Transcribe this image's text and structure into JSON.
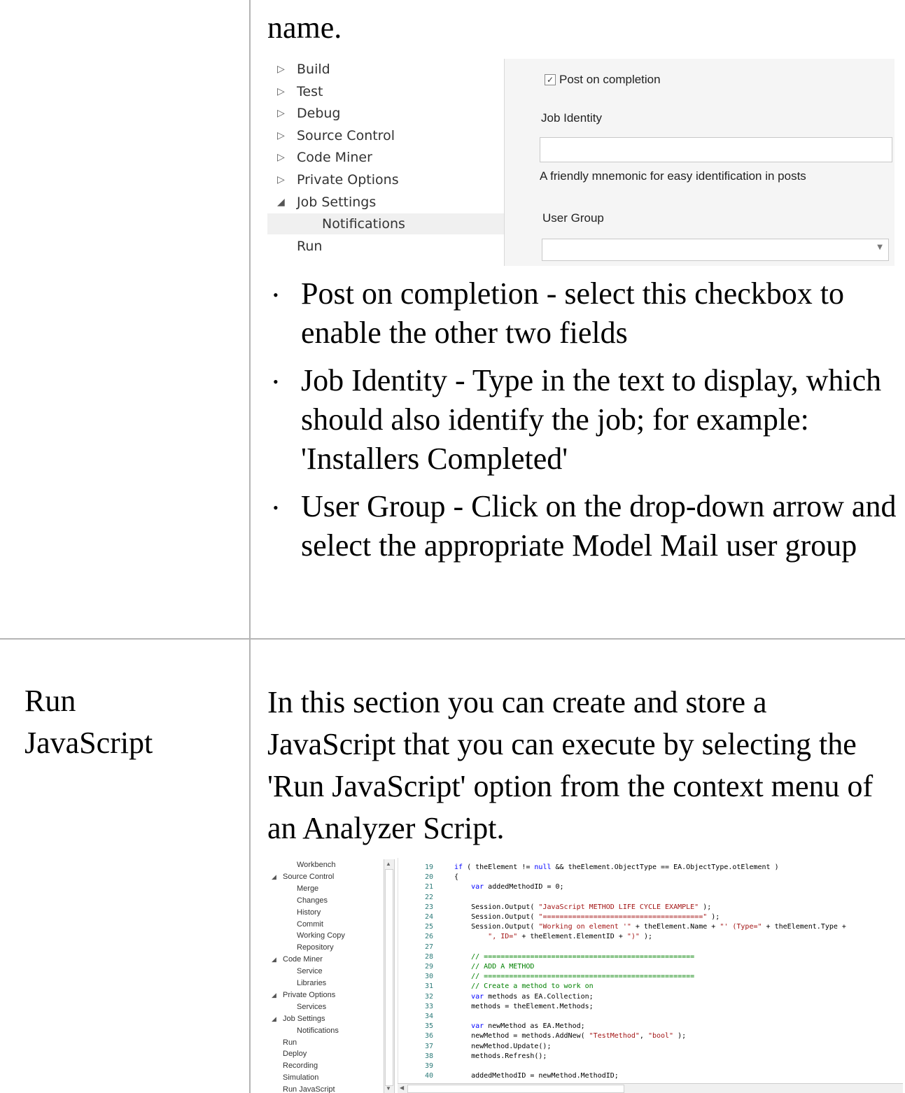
{
  "table": {
    "row1": {
      "top_text": "name.",
      "bullets": [
        "Post on completion - select this checkbox to enable the other two fields",
        "Job Identity - Type in the text to display, which should also identify the job; for example: 'Installers Completed'",
        "User Group - Click on the drop-down arrow and select the appropriate Model Mail user group"
      ]
    },
    "row2": {
      "label_line1": "Run",
      "label_line2": "JavaScript",
      "description": "In this section you can create and store a JavaScript that you can execute by selecting the 'Run JavaScript' option from the context menu of an Analyzer Script."
    }
  },
  "screenshot1": {
    "tree": [
      {
        "label": "Build",
        "arrow": "▷"
      },
      {
        "label": "Test",
        "arrow": "▷"
      },
      {
        "label": "Debug",
        "arrow": "▷"
      },
      {
        "label": "Source Control",
        "arrow": "▷"
      },
      {
        "label": "Code Miner",
        "arrow": "▷"
      },
      {
        "label": "Private Options",
        "arrow": "▷"
      },
      {
        "label": "Job Settings",
        "arrow": "◢"
      },
      {
        "label": "Notifications",
        "arrow": ""
      },
      {
        "label": "Run",
        "arrow": ""
      }
    ],
    "checkbox_label": "Post on completion",
    "checkbox_checked": true,
    "job_identity_label": "Job Identity",
    "job_identity_value": "",
    "job_identity_hint": "A friendly mnemonic for easy identification in posts",
    "user_group_label": "User Group",
    "user_group_value": ""
  },
  "screenshot2": {
    "tree": [
      {
        "label": "Workbench",
        "arrow": ""
      },
      {
        "label": "Source Control",
        "arrow": "◢"
      },
      {
        "label": "Merge",
        "arrow": ""
      },
      {
        "label": "Changes",
        "arrow": ""
      },
      {
        "label": "History",
        "arrow": ""
      },
      {
        "label": "Commit",
        "arrow": ""
      },
      {
        "label": "Working Copy",
        "arrow": ""
      },
      {
        "label": "Repository",
        "arrow": ""
      },
      {
        "label": "Code Miner",
        "arrow": "◢"
      },
      {
        "label": "Service",
        "arrow": ""
      },
      {
        "label": "Libraries",
        "arrow": ""
      },
      {
        "label": "Private Options",
        "arrow": "◢"
      },
      {
        "label": "Services",
        "arrow": ""
      },
      {
        "label": "Job Settings",
        "arrow": "◢"
      },
      {
        "label": "Notifications",
        "arrow": ""
      },
      {
        "label": "Run",
        "arrow": ""
      },
      {
        "label": "Deploy",
        "arrow": ""
      },
      {
        "label": "Recording",
        "arrow": ""
      },
      {
        "label": "Simulation",
        "arrow": ""
      },
      {
        "label": "Run JavaScript",
        "arrow": ""
      }
    ],
    "code": [
      {
        "n": "19",
        "t": "if ( theElement != null && theElement.ObjectType == EA.ObjectType.otElement )"
      },
      {
        "n": "20",
        "t": "{"
      },
      {
        "n": "21",
        "t": "    var addedMethodID = 0;"
      },
      {
        "n": "22",
        "t": ""
      },
      {
        "n": "23",
        "t": "    Session.Output( \"JavaScript METHOD LIFE CYCLE EXAMPLE\" );"
      },
      {
        "n": "24",
        "t": "    Session.Output( \"======================================\" );"
      },
      {
        "n": "25",
        "t": "    Session.Output( \"Working on element '\" + theElement.Name + \"' (Type=\" + theElement.Type +"
      },
      {
        "n": "26",
        "t": "        \", ID=\" + theElement.ElementID + \")\" );"
      },
      {
        "n": "27",
        "t": ""
      },
      {
        "n": "28",
        "t": "    // =================================================="
      },
      {
        "n": "29",
        "t": "    // ADD A METHOD"
      },
      {
        "n": "30",
        "t": "    // =================================================="
      },
      {
        "n": "31",
        "t": "    // Create a method to work on"
      },
      {
        "n": "32",
        "t": "    var methods as EA.Collection;"
      },
      {
        "n": "33",
        "t": "    methods = theElement.Methods;"
      },
      {
        "n": "34",
        "t": ""
      },
      {
        "n": "35",
        "t": "    var newMethod as EA.Method;"
      },
      {
        "n": "36",
        "t": "    newMethod = methods.AddNew( \"TestMethod\", \"bool\" );"
      },
      {
        "n": "37",
        "t": "    newMethod.Update();"
      },
      {
        "n": "38",
        "t": "    methods.Refresh();"
      },
      {
        "n": "39",
        "t": ""
      },
      {
        "n": "40",
        "t": "    addedMethodID = newMethod.MethodID;"
      }
    ]
  }
}
